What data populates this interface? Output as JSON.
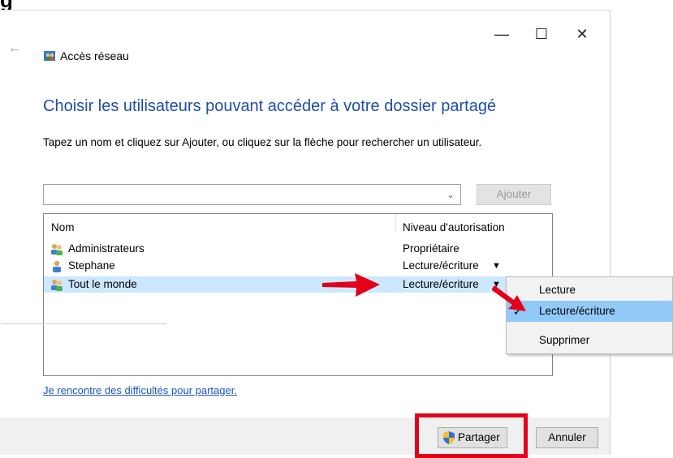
{
  "page": {
    "heading_partial": "g"
  },
  "window": {
    "controls": {
      "minimize": "—",
      "maximize": "☐",
      "close": "✕"
    },
    "back": "←",
    "title": "Accès réseau"
  },
  "dialog": {
    "heading": "Choisir les utilisateurs pouvant accéder à votre dossier partagé",
    "instruction": "Tapez un nom et cliquez sur Ajouter, ou cliquez sur la flèche pour rechercher un utilisateur.",
    "input": {
      "value": "",
      "placeholder": ""
    },
    "add_button": "Ajouter",
    "table": {
      "columns": [
        "Nom",
        "Niveau d'autorisation"
      ],
      "rows": [
        {
          "name": "Administrateurs",
          "permission": "Propriétaire",
          "icon": "group-icon",
          "has_dropdown": false,
          "selected": false
        },
        {
          "name": "Stephane",
          "permission": "Lecture/écriture",
          "icon": "user-icon",
          "has_dropdown": true,
          "selected": false
        },
        {
          "name": "Tout le monde",
          "permission": "Lecture/écriture",
          "icon": "group-icon",
          "has_dropdown": true,
          "selected": true
        }
      ]
    },
    "help_link": "Je rencontre des difficultés pour partager.",
    "share_button": "Partager",
    "cancel_button": "Annuler"
  },
  "context_menu": {
    "items": [
      {
        "label": "Lecture",
        "checked": false
      },
      {
        "label": "Lecture/écriture",
        "checked": true,
        "highlighted": true
      },
      {
        "label": "Supprimer",
        "checked": false
      }
    ]
  },
  "annotations": {
    "arrow_color": "#e2001a",
    "highlight_color": "#e2001a"
  },
  "colors": {
    "accent_heading": "#1f4ea8",
    "link": "#1a56c4",
    "row_selected": "#cce8ff",
    "menu_highlight": "#91c9f7"
  }
}
